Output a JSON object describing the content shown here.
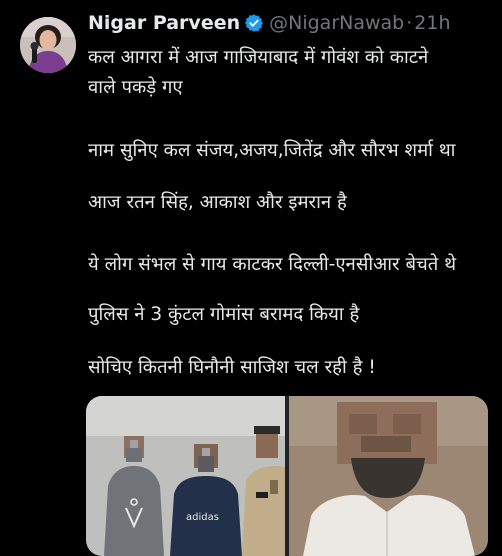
{
  "tweet": {
    "author": {
      "display_name": "Nigar Parveen",
      "handle": "@NigarNawab",
      "verified_icon": "verified-badge-icon",
      "avatar_icon": "avatar-image"
    },
    "separator": "·",
    "timestamp": "21h",
    "body_lines": [
      "कल आगरा में आज गाजियाबाद में गोवंश को काटने",
      "वाले पकड़े गए",
      "नाम सुनिए कल संजय,अजय,जितेंद्र और सौरभ शर्मा था",
      "आज रतन सिंह, आकाश और इमरान है",
      "ये लोग संभल से गाय काटकर दिल्ली-एनसीआर बेचते थे",
      "पुलिस ने 3 कुंटल गोमांस बरामद किया है",
      "सोचिए कितनी घिनौनी साजिश चल रही है !"
    ],
    "media": {
      "left_photo": {
        "shirt_text": "adidas"
      },
      "right_photo": {}
    }
  },
  "colors": {
    "background": "#000000",
    "text_primary": "#e7e9ea",
    "text_secondary": "#71767b",
    "verified_blue": "#1d9bf0"
  }
}
